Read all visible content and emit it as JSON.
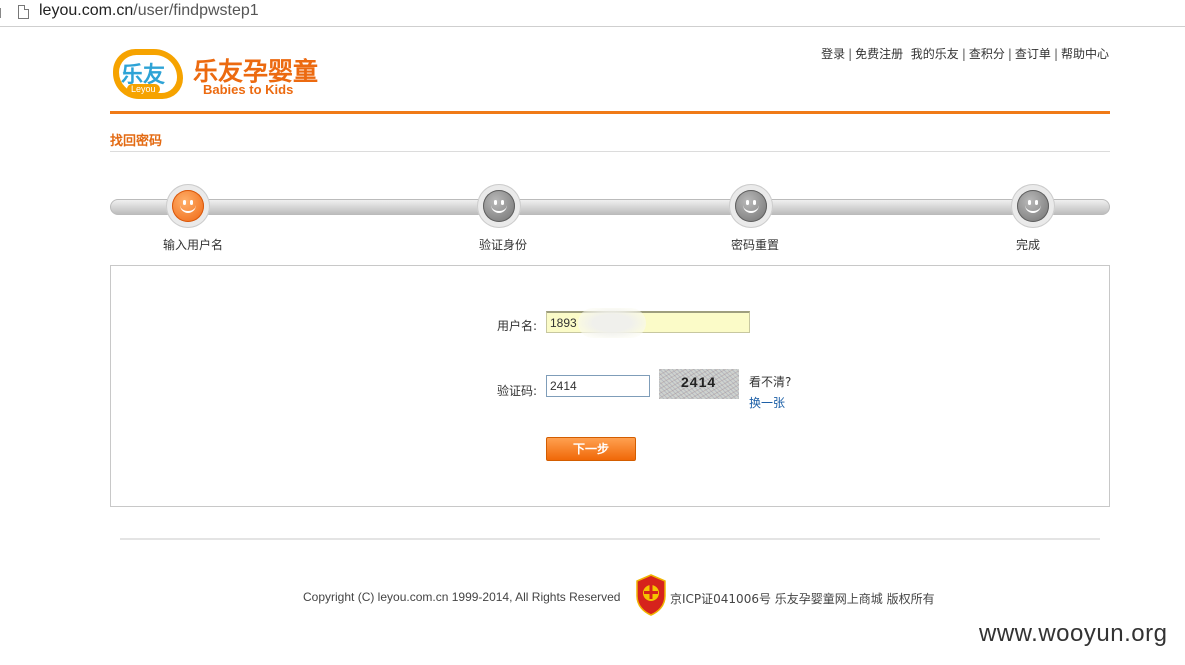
{
  "browser": {
    "url_host": "leyou.com.cn",
    "url_path": "/user/findpwstep1"
  },
  "logo": {
    "badge_text": "乐友",
    "badge_sub": "Leyou",
    "name_cn": "乐友孕婴童",
    "name_en": "Babies to Kids",
    "brand_color": "#ec6a10"
  },
  "topnav": {
    "items": [
      "登录",
      "免费注册",
      "我的乐友",
      "查积分",
      "查订单",
      "帮助中心"
    ]
  },
  "page": {
    "section_title": "找回密码"
  },
  "steps": {
    "items": [
      {
        "label": "输入用户名",
        "active": true
      },
      {
        "label": "验证身份",
        "active": false
      },
      {
        "label": "密码重置",
        "active": false
      },
      {
        "label": "完成",
        "active": false
      }
    ]
  },
  "form": {
    "username_label": "用户名:",
    "username_value": "1893",
    "captcha_label": "验证码:",
    "captcha_value": "2414",
    "captcha_image_text": "2414",
    "unclear_text": "看不清?",
    "refresh_link": "换一张",
    "next_button": "下一步"
  },
  "footer": {
    "copyright": "Copyright (C) leyou.com.cn 1999-2014, All Rights Reserved",
    "icp": "京ICP证041006号 乐友孕婴童网上商城 版权所有"
  },
  "watermark": "www.wooyun.org"
}
